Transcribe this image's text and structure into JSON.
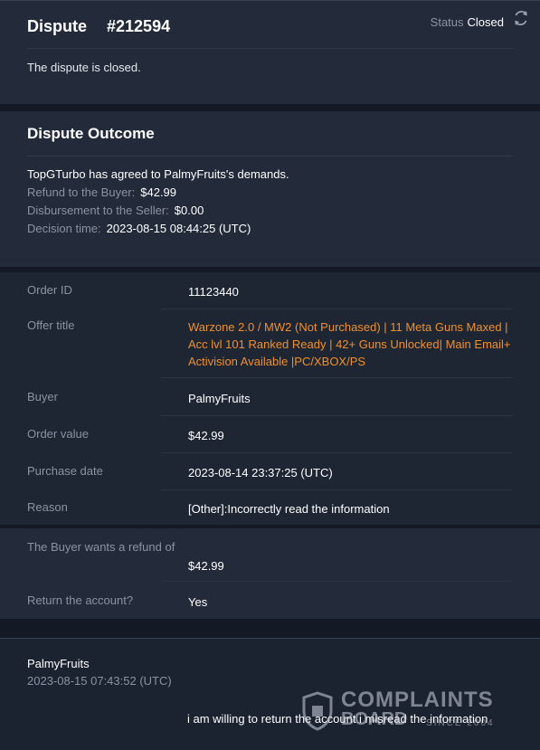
{
  "dispute": {
    "title": "Dispute",
    "number": "#212594",
    "status_label": "Status",
    "status_value": "Closed",
    "closed_message": "The dispute is closed."
  },
  "outcome": {
    "title": "Dispute Outcome",
    "summary": "TopGTurbo has agreed to PalmyFruits's demands.",
    "refund_label": "Refund to the Buyer:",
    "refund_value": "$42.99",
    "disbursement_label": "Disbursement to the Seller:",
    "disbursement_value": "$0.00",
    "decision_label": "Decision time:",
    "decision_value": "2023-08-15 08:44:25 (UTC)"
  },
  "details": [
    {
      "label": "Order ID",
      "value": "11123440"
    },
    {
      "label": "Offer title",
      "value": "Warzone 2.0 / MW2 (Not Purchased) | 11 Meta Guns Maxed | Acc lvl 101 Ranked Ready | 42+ Guns Unlocked| Main Email+ Activision Available |PC/XBOX/PS"
    },
    {
      "label": "Buyer",
      "value": "PalmyFruits"
    },
    {
      "label": "Order value",
      "value": "$42.99"
    },
    {
      "label": "Purchase date",
      "value": "2023-08-14 23:37:25 (UTC)"
    },
    {
      "label": "Reason",
      "value": "[Other]:Incorrectly read the information"
    }
  ],
  "refund": {
    "want_label": "The Buyer wants a refund of",
    "want_value": "$42.99",
    "return_label": "Return the account?",
    "return_value": "Yes"
  },
  "message": {
    "author": "PalmyFruits",
    "time": "2023-08-15 07:43:52 (UTC)",
    "text": "i am willing to return the account i misread the information"
  },
  "watermark": {
    "line1": "COMPLAINTS",
    "line2": "BOARD",
    "line3": "SINCE 2004"
  },
  "colors": {
    "accent_orange": "#f0902a",
    "panel": "#232b3a",
    "background": "#1b2230",
    "muted_text": "#8a93a3"
  }
}
